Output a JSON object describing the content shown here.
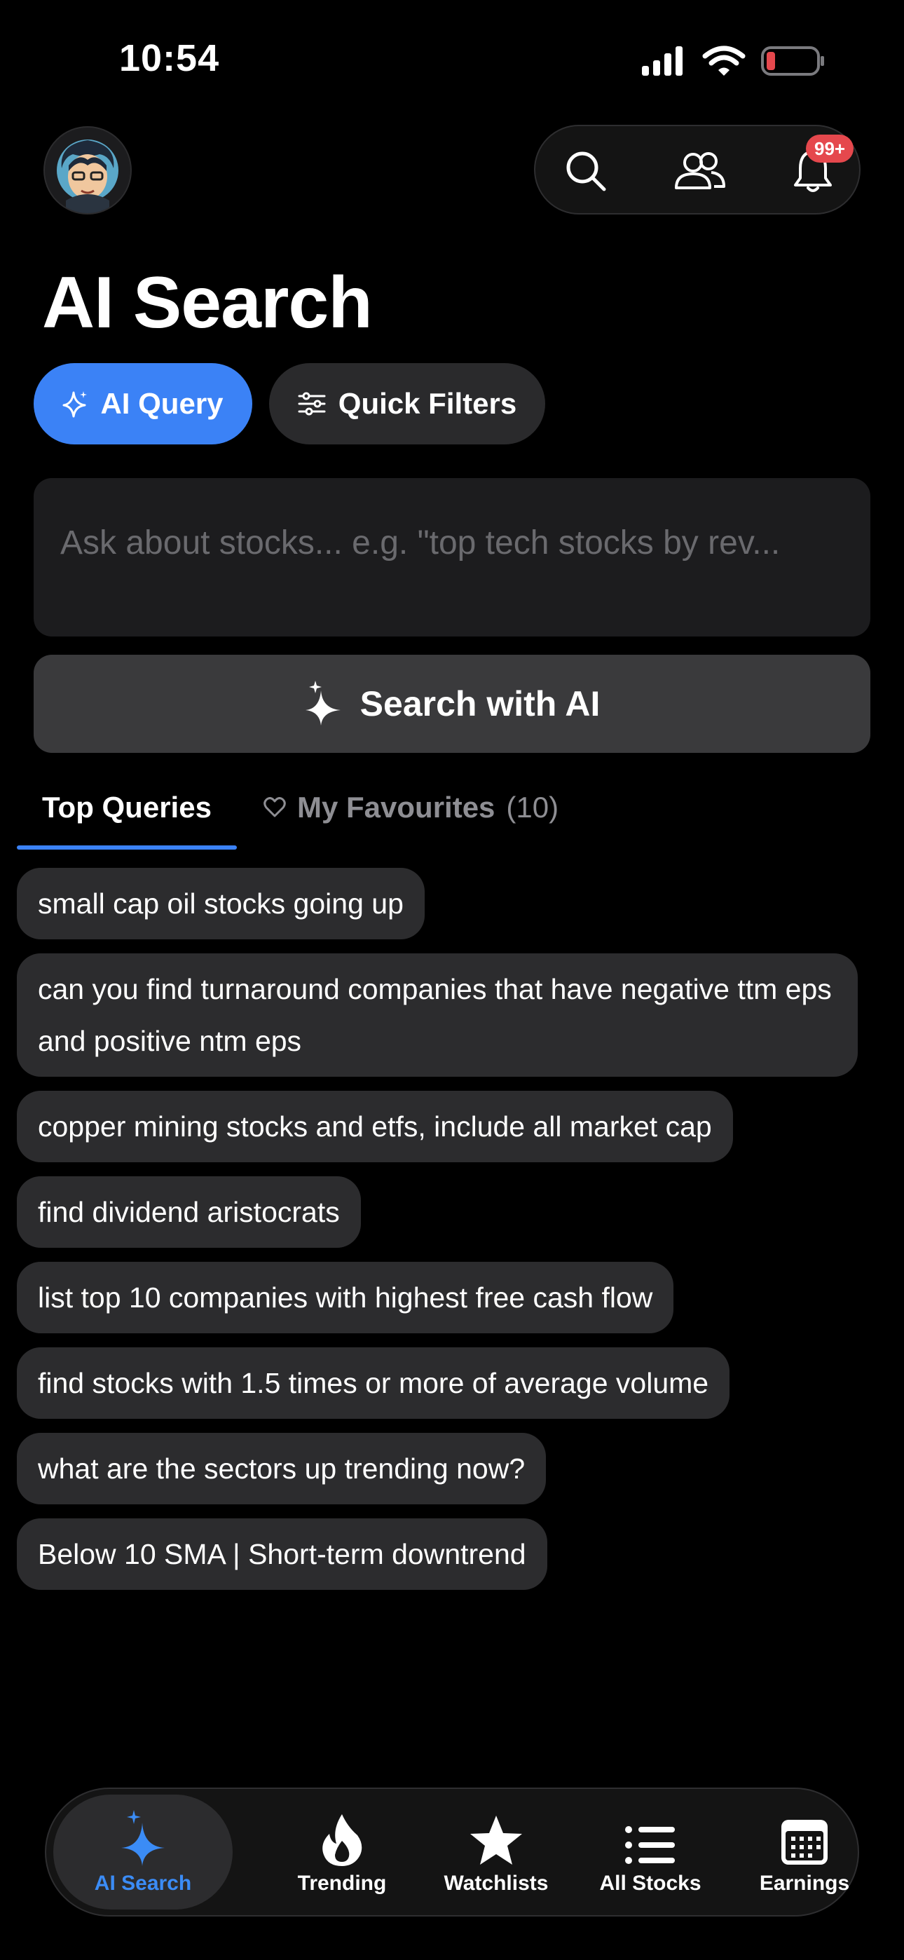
{
  "status_bar": {
    "time": "10:54"
  },
  "header": {
    "notification_badge": "99+"
  },
  "page": {
    "title": "AI Search"
  },
  "modes": {
    "ai_query": "AI Query",
    "quick_filters": "Quick Filters"
  },
  "query": {
    "placeholder": "Ask about stocks... e.g. \"top tech stocks by rev...",
    "value": ""
  },
  "search_button": {
    "label": "Search with AI"
  },
  "tabs": {
    "top_queries": "Top Queries",
    "favourites": "My Favourites",
    "favourites_count": "(10)"
  },
  "queries": [
    "small cap oil stocks going up",
    "can you find turnaround companies that have negative ttm eps and positive ntm eps",
    "copper mining stocks and etfs, include all market cap",
    "find dividend aristocrats",
    "list top 10 companies with highest free cash flow",
    "find stocks with 1.5 times or more of average volume",
    "what are the sectors up trending now?",
    "Below 10 SMA | Short-term downtrend"
  ],
  "nav": {
    "ai_search": "AI Search",
    "trending": "Trending",
    "watchlists": "Watchlists",
    "all_stocks": "All Stocks",
    "earnings": "Earnings"
  },
  "colors": {
    "accent": "#3b82f6",
    "badge": "#e5484d",
    "battery_low": "#e5484d"
  }
}
